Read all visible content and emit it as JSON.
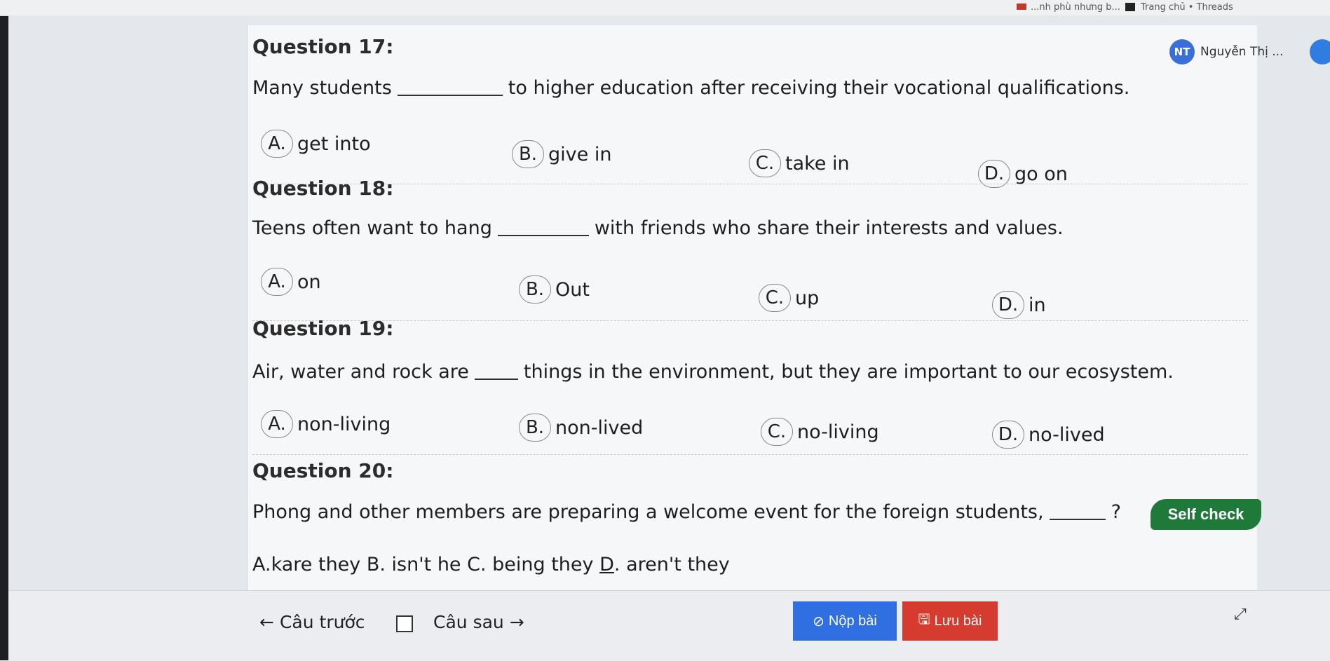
{
  "tabs": [
    {
      "label": "...nh phù nhưng b..."
    },
    {
      "label": "Trang chủ • Threads"
    }
  ],
  "user": {
    "initials": "NT",
    "name": "Nguyễn Thị ..."
  },
  "questions": [
    {
      "title": "Question 17:",
      "text_before": "Many students",
      "text_after": "to higher education after receiving their vocational qualifications.",
      "options": [
        {
          "letter": "A.",
          "text": "get into"
        },
        {
          "letter": "B.",
          "text": "give in"
        },
        {
          "letter": "C.",
          "text": "take in"
        },
        {
          "letter": "D.",
          "text": "go on"
        }
      ]
    },
    {
      "title": "Question 18:",
      "text_before": "Teens often want to hang",
      "text_after": "with friends who share their interests and values.",
      "options": [
        {
          "letter": "A.",
          "text": "on"
        },
        {
          "letter": "B.",
          "text": "Out"
        },
        {
          "letter": "C.",
          "text": "up"
        },
        {
          "letter": "D.",
          "text": "in"
        }
      ]
    },
    {
      "title": "Question 19:",
      "text_before": "Air, water and rock are",
      "text_after": "things in the environment, but they are important to our ecosystem.",
      "options": [
        {
          "letter": "A.",
          "text": "non-living"
        },
        {
          "letter": "B.",
          "text": "non-lived"
        },
        {
          "letter": "C.",
          "text": "no-living"
        },
        {
          "letter": "D.",
          "text": "no-lived"
        }
      ]
    },
    {
      "title": "Question 20:",
      "text_before": "Phong and other members are preparing a welcome event for the foreign students,",
      "text_after": "?",
      "answer_pre": "A.kare they B. isn't he C. being they ",
      "answer_d": "D",
      "answer_post": ". aren't they"
    }
  ],
  "self_check_label": "Self check",
  "footer": {
    "prev_arrow": "←",
    "prev_label": "Câu trước",
    "next_label": "Câu sau",
    "next_arrow": "→",
    "submit_icon": "⊘",
    "submit_label": "Nộp bài",
    "save_icon": "🖫",
    "save_label": "Lưu bài",
    "resize_icon": "⤢"
  },
  "colors": {
    "submit": "#2f6fe2",
    "save": "#d63b2f",
    "self_check": "#1f7a3a",
    "avatar": "#3b6fd8"
  }
}
